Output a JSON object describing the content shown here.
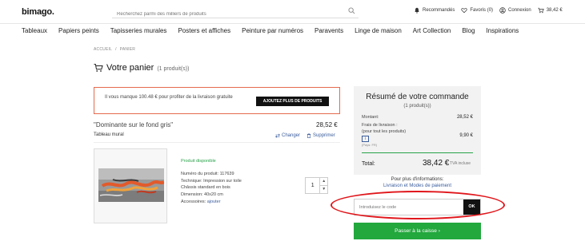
{
  "header": {
    "logo": "bimago.",
    "search_placeholder": "Recherchez parmi des milliers de produits",
    "links": {
      "recommended": "Recommandés",
      "favorites": "Favoris (0)",
      "login": "Connexion",
      "cart": "38,42 €"
    }
  },
  "nav": [
    "Tableaux",
    "Papiers peints",
    "Tapisseries murales",
    "Posters et affiches",
    "Peinture par numéros",
    "Paravents",
    "Linge de maison",
    "Art Collection",
    "Blog",
    "Inspirations"
  ],
  "breadcrumb": [
    "ACCUEIL",
    "PANIER"
  ],
  "cart": {
    "title": "Votre panier",
    "count": "(1 produit(s))"
  },
  "alert": {
    "message": "Il vous manque 100.48 € pour profiter de la livraison gratuite",
    "button": "AJOUTEZ PLUS DE PRODUITS"
  },
  "product": {
    "name": "\"Dominante sur le fond gris\"",
    "price": "28,52 €",
    "type": "Tableau mural",
    "change": "Changer",
    "delete": "Supprimer",
    "availability": "Produit disponible",
    "number": "Numéro du produit: 117639",
    "technique": "Technique: Impression sur toile",
    "frame": "Châssis standard en bois",
    "dimensions": "Dimension: 40x20 cm",
    "accessories_label": "Accessoires:",
    "accessories_link": "ajouter",
    "quantity": "1"
  },
  "summary": {
    "title": "Résumé de votre commande",
    "count": "(1 produit(s))",
    "amount_label": "Montant:",
    "amount": "28,52 €",
    "shipping_label_1": "Frais de livraison :",
    "shipping_label_2": "(pour tout les produits)",
    "info_icon": "i",
    "country": "(Pays: FR)",
    "shipping": "9,90 €",
    "total_label": "Total:",
    "total": "38,42 €",
    "tva": "TVA incluse"
  },
  "info": {
    "line1": "Pour plus d'informations:",
    "link": "Livraison et Modes de paiement"
  },
  "promo": {
    "placeholder": "Introduisez le code",
    "ok": "OK"
  },
  "checkout": "Passer à la caisse  ›",
  "colors": {
    "accent_green": "#22a83d",
    "alert_border": "#e56a4e",
    "annotation_ring": "#e0161b",
    "link_blue": "#3a5c9c"
  }
}
